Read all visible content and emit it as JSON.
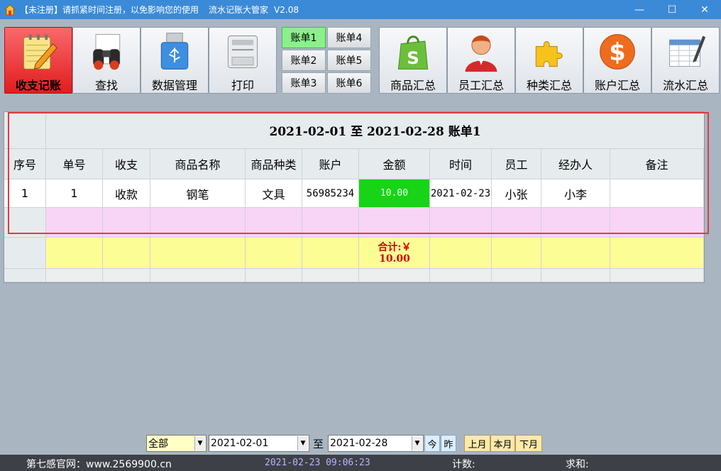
{
  "window": {
    "title_notice": "【未注册】请抓紧时间注册，以免影响您的使用",
    "app_name": "流水记账大管家",
    "version": "V2.08",
    "minimize": "—",
    "maximize": "☐",
    "close": "✕"
  },
  "toolbar": {
    "record": "收支记账",
    "search": "查找",
    "data_manage": "数据管理",
    "print": "打印",
    "goods_summary": "商品汇总",
    "staff_summary": "员工汇总",
    "category_summary": "种类汇总",
    "account_summary": "账户汇总",
    "flow_summary": "流水汇总"
  },
  "bills": [
    "账单1",
    "账单2",
    "账单3",
    "账单4",
    "账单5",
    "账单6"
  ],
  "grid": {
    "title": "2021-02-01  至  2021-02-28  账单1",
    "headers": [
      "序号",
      "单号",
      "收支",
      "商品名称",
      "商品种类",
      "账户",
      "金额",
      "时间",
      "员工",
      "经办人",
      "备注"
    ],
    "rows": [
      [
        "1",
        "1",
        "收款",
        "钢笔",
        "文具",
        "56985234",
        "10.00",
        "2021-02-23",
        "小张",
        "小李",
        ""
      ]
    ],
    "total_label": "合计:￥",
    "total_value": "10.00"
  },
  "filters": {
    "type_value": "全部",
    "date_from": "2021-02-01",
    "to_label": "至",
    "date_to": "2021-02-28",
    "today": "今",
    "yesterday": "昨",
    "last_month": "上月",
    "this_month": "本月",
    "next_month": "下月"
  },
  "status": {
    "site": "第七感官网：www.2569900.cn",
    "datetime": "2021-02-23 09:06:23",
    "count_label": "计数:",
    "sum_label": "求和:"
  },
  "colors": {
    "titlebar": "#3b8ad8",
    "active_tool": "#e21c1f",
    "selected_bill": "#8bf08b",
    "amount_cell": "#17d417",
    "pending_row": "#f8d4f7",
    "total_row": "#fdfd96",
    "total_text": "#d40000",
    "highlight_box": "#e23b3b"
  }
}
